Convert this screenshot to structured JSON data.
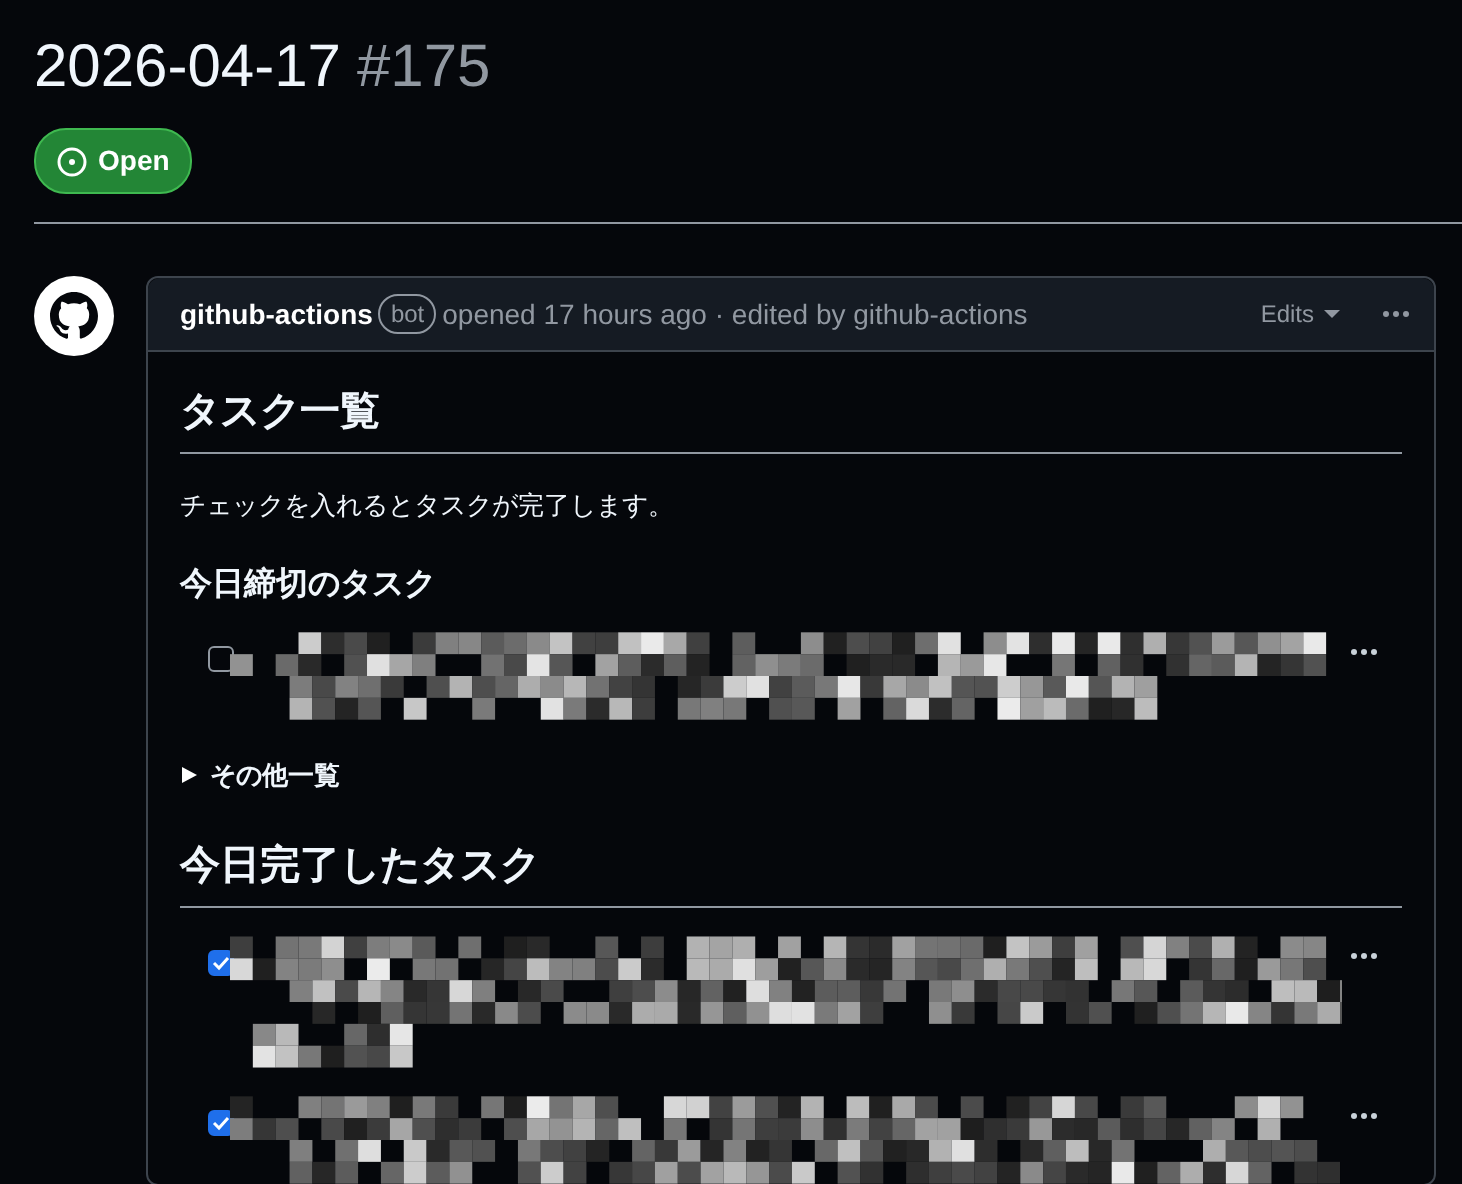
{
  "issue": {
    "title": "2026-04-17",
    "number": "#175",
    "state": "Open"
  },
  "comment": {
    "author": "github-actions",
    "author_badge": "bot",
    "meta": "opened 17 hours ago · edited by github-actions",
    "edits_label": "Edits",
    "body": {
      "heading": "タスク一覧",
      "intro": "チェックを入れるとタスクが完了します。",
      "due_heading": "今日締切のタスク",
      "due_tasks": [
        {
          "checked": false
        }
      ],
      "details": {
        "label": "その他一覧",
        "expanded": false
      },
      "done_heading": "今日完了したタスク",
      "done_tasks": [
        {
          "checked": true
        },
        {
          "checked": true
        }
      ]
    }
  }
}
